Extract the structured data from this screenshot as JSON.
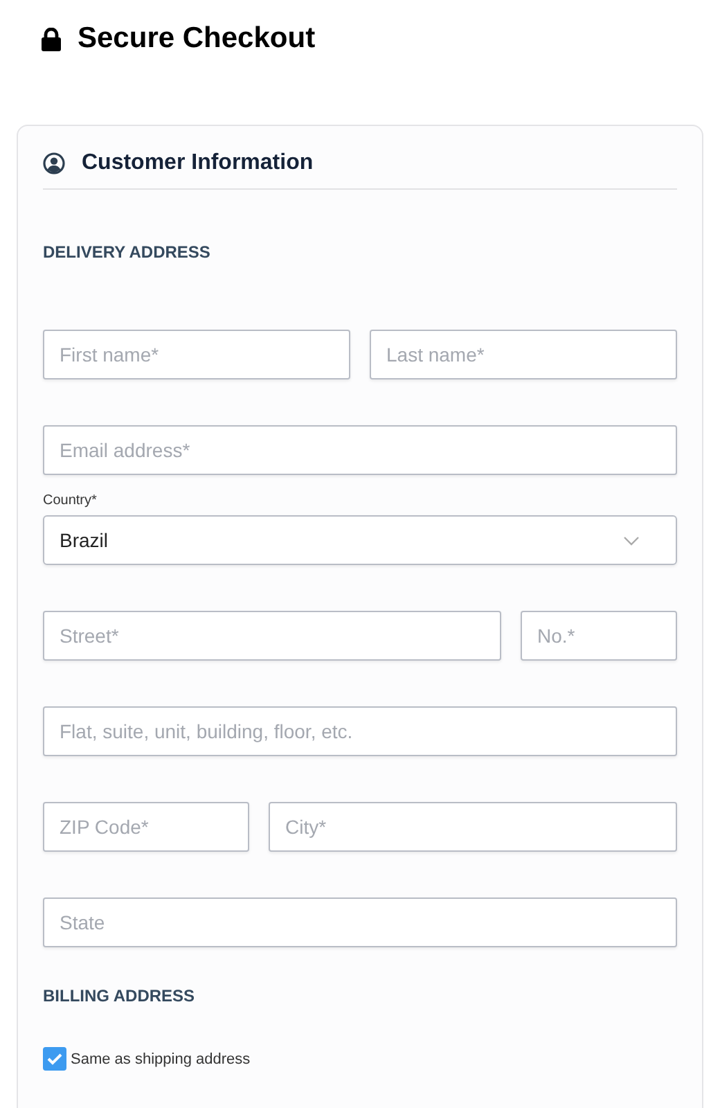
{
  "page_title": "Secure Checkout",
  "card": {
    "title": "Customer Information",
    "delivery_heading": "DELIVERY ADDRESS",
    "rows": [
      {
        "fields": [
          {
            "kind": "text",
            "placeholder": "First name*"
          },
          {
            "kind": "text",
            "placeholder": "Last name*"
          }
        ]
      },
      {
        "fields": [
          {
            "kind": "text",
            "placeholder": "Email address*"
          }
        ]
      },
      {
        "fields": [
          {
            "kind": "select",
            "label": "Country*",
            "value": "Brazil"
          }
        ]
      },
      {
        "fields": [
          {
            "kind": "text",
            "placeholder": "Street*"
          },
          {
            "kind": "text",
            "placeholder": "No.*",
            "narrow": true
          }
        ]
      },
      {
        "fields": [
          {
            "kind": "text",
            "placeholder": "Flat, suite, unit, building, floor, etc."
          }
        ]
      },
      {
        "fields": [
          {
            "kind": "text",
            "placeholder": "ZIP Code*",
            "short": true
          },
          {
            "kind": "text",
            "placeholder": "City*"
          }
        ]
      },
      {
        "fields": [
          {
            "kind": "text",
            "placeholder": "State"
          }
        ]
      }
    ],
    "billing_heading": "BILLING ADDRESS",
    "same_as_shipping": {
      "label": "Same as shipping address",
      "checked": true
    }
  }
}
